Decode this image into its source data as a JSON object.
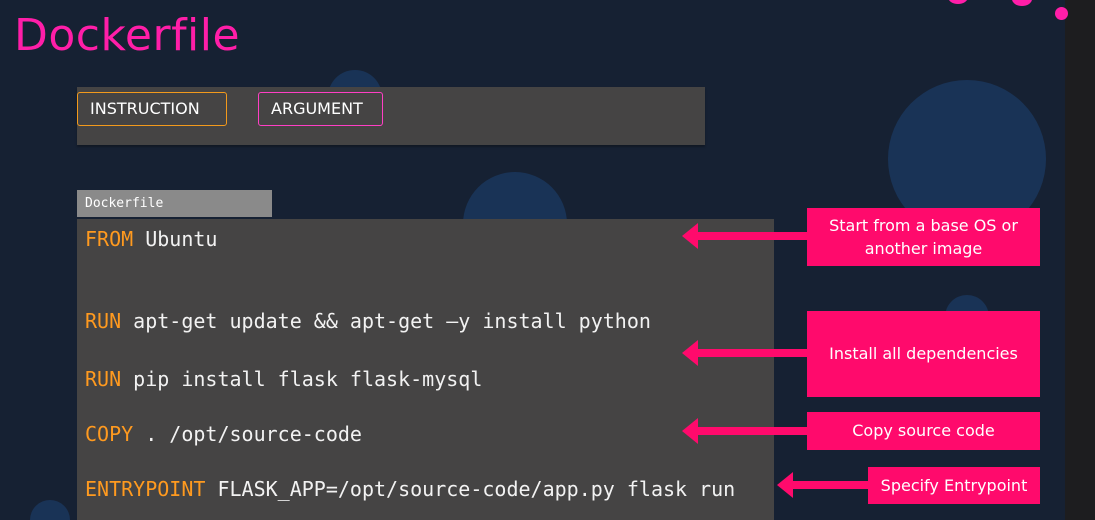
{
  "slide": {
    "title": "Dockerfile"
  },
  "legend": {
    "instruction_label": "INSTRUCTION",
    "argument_label": "ARGUMENT"
  },
  "editor": {
    "tab_label": "Dockerfile",
    "lines": [
      {
        "instruction": "FROM",
        "argument": " Ubuntu"
      },
      {
        "instruction": "RUN",
        "argument": " apt-get update && apt-get –y install python"
      },
      {
        "instruction": "RUN",
        "argument": " pip install flask flask-mysql"
      },
      {
        "instruction": "COPY",
        "argument": " . /opt/source-code"
      },
      {
        "instruction": "ENTRYPOINT",
        "argument": " FLASK_APP=/opt/source-code/app.py flask run"
      }
    ]
  },
  "callouts": [
    {
      "text": "Start from a base OS or another image"
    },
    {
      "text": "Install all dependencies"
    },
    {
      "text": "Copy source code"
    },
    {
      "text": "Specify Entrypoint"
    }
  ],
  "colors": {
    "accent": "#ff1ea8",
    "callout": "#ff0a6c",
    "instruction": "#ff9a1f",
    "background": "#162133",
    "panel": "#454444"
  }
}
